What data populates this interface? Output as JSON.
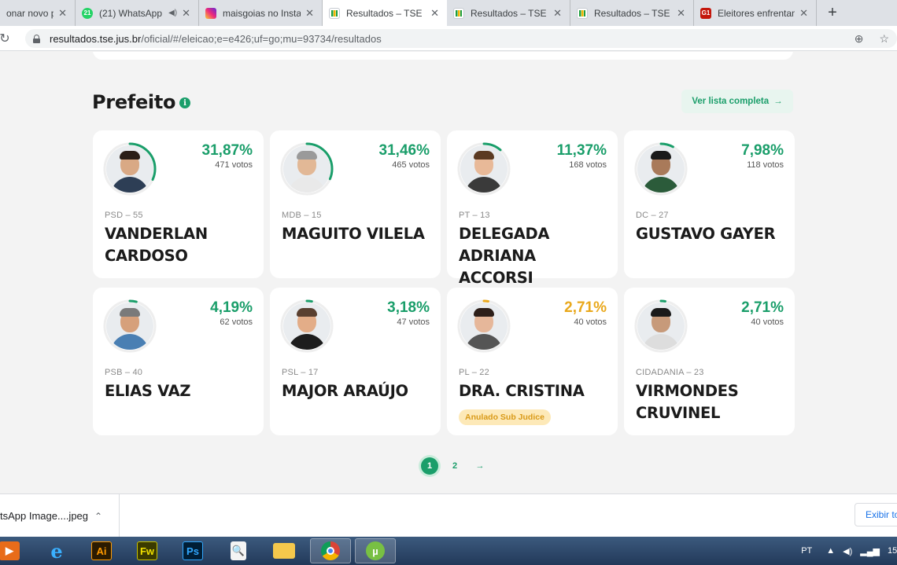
{
  "browser": {
    "tabs": [
      {
        "title": "onar novo pos",
        "favicon": "blank",
        "active": false
      },
      {
        "title": "(21) WhatsApp",
        "favicon": "whatsapp-icon",
        "badge": "21",
        "active": false
      },
      {
        "title": "maisgoias no Instag",
        "favicon": "instagram-icon",
        "active": false
      },
      {
        "title": "Resultados – TSE",
        "favicon": "tse-icon",
        "active": true
      },
      {
        "title": "Resultados – TSE",
        "favicon": "tse-icon",
        "active": false
      },
      {
        "title": "Resultados – TSE",
        "favicon": "tse-icon",
        "active": false
      },
      {
        "title": "Eleitores enfrentam",
        "favicon": "g1-icon",
        "active": false
      }
    ],
    "g1_label": "G1",
    "url_host": "resultados.tse.jus.br",
    "url_path": "/oficial/#/eleicao;e=e426;uf=go;mu=93734/resultados"
  },
  "section": {
    "title": "Prefeito",
    "full_list_label": "Ver lista completa"
  },
  "candidates": [
    {
      "percent": "31,87%",
      "votes": "471 votos",
      "party": "PSD – 55",
      "name": "VANDERLAN CARDOSO",
      "share": 0.3187,
      "color": "#1a9e6a"
    },
    {
      "percent": "31,46%",
      "votes": "465 votos",
      "party": "MDB – 15",
      "name": "MAGUITO VILELA",
      "share": 0.3146,
      "color": "#1a9e6a"
    },
    {
      "percent": "11,37%",
      "votes": "168 votos",
      "party": "PT – 13",
      "name": "DELEGADA ADRIANA ACCORSI",
      "share": 0.1137,
      "color": "#1a9e6a"
    },
    {
      "percent": "7,98%",
      "votes": "118 votos",
      "party": "DC – 27",
      "name": "GUSTAVO GAYER",
      "share": 0.0798,
      "color": "#1a9e6a"
    },
    {
      "percent": "4,19%",
      "votes": "62 votos",
      "party": "PSB – 40",
      "name": "ELIAS VAZ",
      "share": 0.0419,
      "color": "#1a9e6a"
    },
    {
      "percent": "3,18%",
      "votes": "47 votos",
      "party": "PSL – 17",
      "name": "MAJOR ARAÚJO",
      "share": 0.0318,
      "color": "#1a9e6a"
    },
    {
      "percent": "2,71%",
      "votes": "40 votos",
      "party": "PL – 22",
      "name": "DRA. CRISTINA",
      "share": 0.0271,
      "color": "#e9a81c",
      "badge": "Anulado Sub Judice"
    },
    {
      "percent": "2,71%",
      "votes": "40 votos",
      "party": "CIDADANIA – 23",
      "name": "VIRMONDES CRUVINEL",
      "share": 0.0271,
      "color": "#1a9e6a"
    }
  ],
  "pagination": {
    "pages": [
      "1",
      "2"
    ],
    "current": "1",
    "next": "→"
  },
  "downloads": {
    "file": "tsApp Image....jpeg",
    "show_all": "Exibir to"
  },
  "taskbar": {
    "apps": [
      "media-player-icon",
      "internet-explorer-icon",
      "illustrator-icon",
      "fireworks-icon",
      "photoshop-icon",
      "document-search-icon",
      "file-explorer-icon",
      "chrome-icon",
      "utorrent-icon"
    ],
    "ai_label": "Ai",
    "fw_label": "Fw",
    "ps_label": "Ps",
    "language": "PT",
    "clock": "15"
  }
}
